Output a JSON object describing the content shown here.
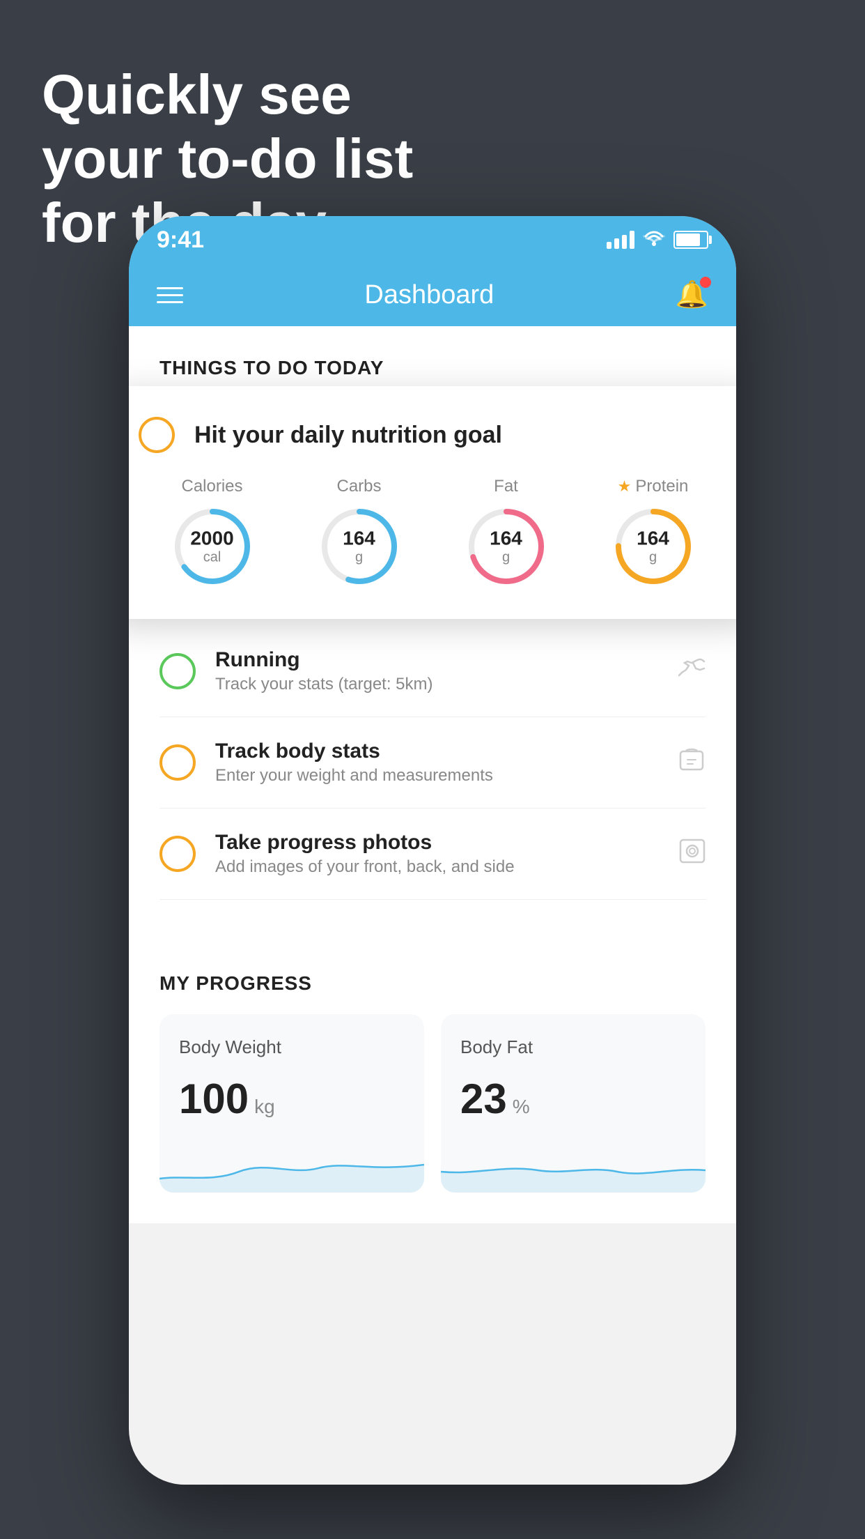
{
  "headline": {
    "line1": "Quickly see",
    "line2": "your to-do list",
    "line3": "for the day."
  },
  "phone": {
    "status_bar": {
      "time": "9:41"
    },
    "nav_bar": {
      "title": "Dashboard"
    },
    "things_section": {
      "title": "THINGS TO DO TODAY"
    },
    "nutrition_card": {
      "title": "Hit your daily nutrition goal",
      "macros": [
        {
          "label": "Calories",
          "value": "2000",
          "unit": "cal",
          "color": "#4db8e8",
          "percent": 65,
          "star": false
        },
        {
          "label": "Carbs",
          "value": "164",
          "unit": "g",
          "color": "#4db8e8",
          "percent": 55,
          "star": false
        },
        {
          "label": "Fat",
          "value": "164",
          "unit": "g",
          "color": "#f06b8a",
          "percent": 70,
          "star": false
        },
        {
          "label": "Protein",
          "value": "164",
          "unit": "g",
          "color": "#f5a623",
          "percent": 75,
          "star": true
        }
      ]
    },
    "todo_items": [
      {
        "name": "Running",
        "sub": "Track your stats (target: 5km)",
        "circle_color": "green",
        "icon": "👟"
      },
      {
        "name": "Track body stats",
        "sub": "Enter your weight and measurements",
        "circle_color": "orange",
        "icon": "⚖"
      },
      {
        "name": "Take progress photos",
        "sub": "Add images of your front, back, and side",
        "circle_color": "orange",
        "icon": "👤"
      }
    ],
    "progress_section": {
      "title": "MY PROGRESS",
      "cards": [
        {
          "title": "Body Weight",
          "value": "100",
          "unit": "kg"
        },
        {
          "title": "Body Fat",
          "value": "23",
          "unit": "%"
        }
      ]
    }
  }
}
